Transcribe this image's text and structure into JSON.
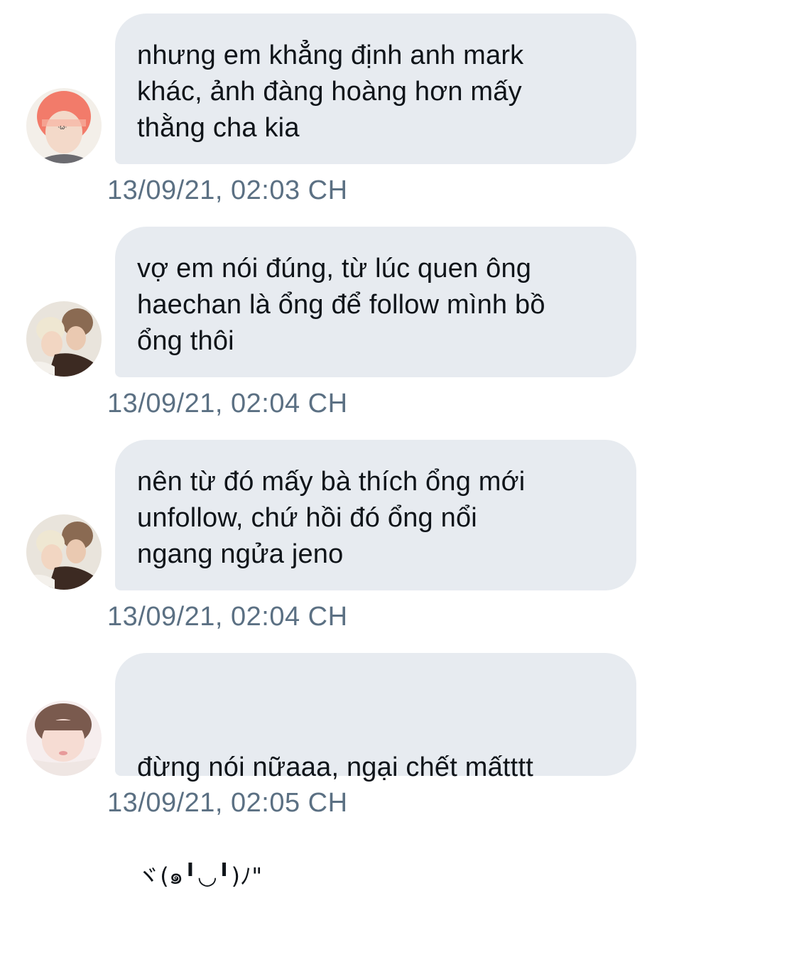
{
  "messages": [
    {
      "text": "nhưng em khẳng định anh mark\nkhác, ảnh đàng hoàng hơn mấy\nthằng cha kia",
      "timestamp": "13/09/21, 02:03 CH",
      "avatar": "avatar-pink-hair-icon"
    },
    {
      "text": "vợ em nói đúng, từ lúc quen ông\nhaechan là ổng để follow mình bồ\nổng thôi",
      "timestamp": "13/09/21, 02:04 CH",
      "avatar": "avatar-couple-photo-icon"
    },
    {
      "text": "nên từ đó mấy bà thích ổng mới\nunfollow, chứ hồi đó ổng nổi\nngang ngửa jeno",
      "timestamp": "13/09/21, 02:04 CH",
      "avatar": "avatar-couple-photo-icon"
    },
    {
      "text": "đừng nói nữaaa, ngại chết mấtttt",
      "text_line2": "ヾ(๑╹◡╹)ﾉ\"",
      "timestamp": "13/09/21, 02:05 CH",
      "avatar": "avatar-portrait-photo-icon"
    }
  ],
  "colors": {
    "bubble": "#e7ebf0",
    "text": "#0f1419",
    "timestamp": "#5b7083"
  }
}
